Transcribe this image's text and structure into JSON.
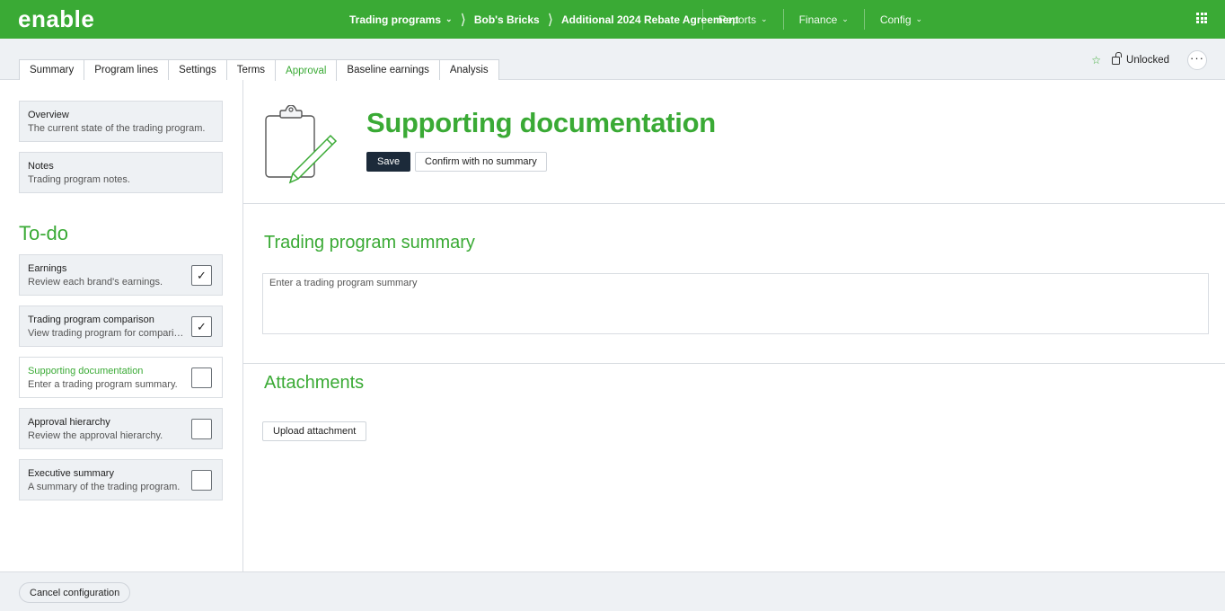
{
  "app": {
    "logo_text": "enable",
    "breadcrumbs": [
      {
        "label": "Trading programs"
      },
      {
        "label": "Bob's Bricks"
      },
      {
        "label": "Additional 2024 Rebate Agreement"
      }
    ],
    "nav": [
      {
        "label": "Reports"
      },
      {
        "label": "Finance"
      },
      {
        "label": "Config"
      }
    ],
    "accent_color": "#3aaa35"
  },
  "tabs": [
    {
      "label": "Summary"
    },
    {
      "label": "Program lines"
    },
    {
      "label": "Settings"
    },
    {
      "label": "Terms"
    },
    {
      "label": "Approval",
      "active": true
    },
    {
      "label": "Baseline earnings"
    },
    {
      "label": "Analysis"
    }
  ],
  "tab_right": {
    "lock_label": "Unlocked"
  },
  "sidebar": {
    "info_cards": [
      {
        "title": "Overview",
        "subtitle": "The current state of the trading program."
      },
      {
        "title": "Notes",
        "subtitle": "Trading program notes."
      }
    ],
    "todo_title": "To-do",
    "todo_items": [
      {
        "title": "Earnings",
        "subtitle": "Review each brand's earnings.",
        "checked": true
      },
      {
        "title": "Trading program comparison",
        "subtitle": "View trading program for comparison.",
        "checked": true
      },
      {
        "title": "Supporting documentation",
        "subtitle": "Enter a trading program summary.",
        "checked": false,
        "current": true
      },
      {
        "title": "Approval hierarchy",
        "subtitle": "Review the approval hierarchy.",
        "checked": false
      },
      {
        "title": "Executive summary",
        "subtitle": "A summary of the trading program.",
        "checked": false
      }
    ]
  },
  "main": {
    "title": "Supporting documentation",
    "save_label": "Save",
    "confirm_label": "Confirm with no summary",
    "summary_title": "Trading program summary",
    "summary_placeholder": "Enter a trading program summary",
    "summary_value": "",
    "attachments_title": "Attachments",
    "upload_label": "Upload attachment"
  },
  "footer": {
    "cancel_label": "Cancel configuration"
  }
}
